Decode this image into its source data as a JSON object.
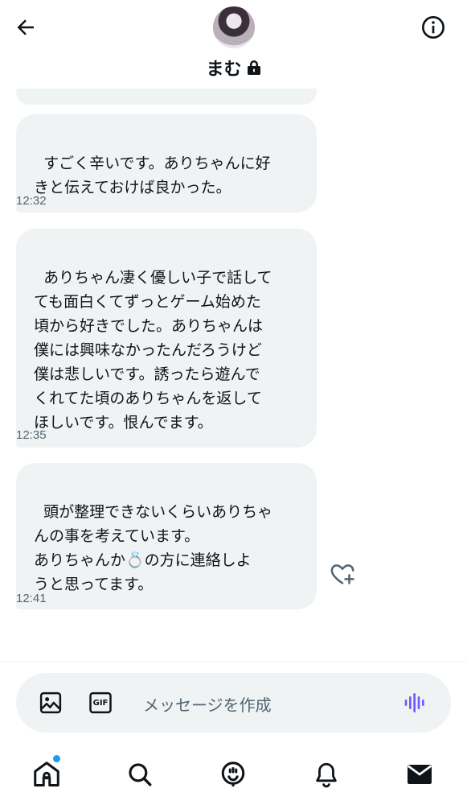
{
  "header": {
    "title": "まむ",
    "back_icon": "arrow-left-icon",
    "info_icon": "info-icon",
    "lock_icon": "lock-icon"
  },
  "messages": [
    {
      "text": "すごく辛いです。ありちゃんに好\nきと伝えておけば良かった。",
      "time": "12:32"
    },
    {
      "text": "ありちゃん凄く優しい子で話して\nても面白くてずっとゲーム始めた\n頃から好きでした。ありちゃんは\n僕には興味なかったんだろうけど\n僕は悲しいです。誘ったら遊んで\nくれてた頃のありちゃんを返して\nほしいです。恨んでます。",
      "time": "12:35"
    },
    {
      "text": "頭が整理できないくらいありちゃ\nんの事を考えています。\nありちゃんか💍の方に連絡しよ\nうと思ってます。",
      "time": "12:41"
    }
  ],
  "composer": {
    "placeholder": "メッセージを作成",
    "gif_label": "GIF",
    "image_icon": "image-icon",
    "voice_icon": "voice-wave-icon"
  },
  "nav": {
    "items": [
      "home-icon",
      "search-icon",
      "communities-icon",
      "bell-icon",
      "mail-icon"
    ],
    "home_has_notification": true
  },
  "colors": {
    "bubble_bg": "#eff3f4",
    "accent_blue": "#1d9bf0",
    "voice_purple": "#7856ff",
    "text_secondary": "#536471"
  }
}
